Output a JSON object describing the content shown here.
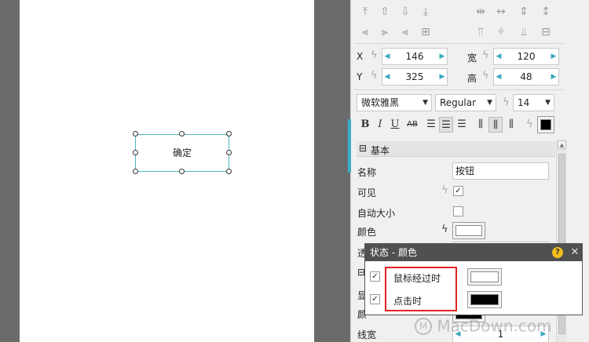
{
  "canvas": {
    "widget_label": "确定"
  },
  "toolbar": {
    "align_row_icons": [
      "align-top-icon",
      "align-middle-icon",
      "align-bottom-icon",
      "align-baseline-icon"
    ],
    "distribute_row_icons": [
      "distribute-horizontal-icon",
      "distribute-width-icon",
      "distribute-vertical-icon",
      "distribute-height-icon"
    ]
  },
  "geometry_fields": {
    "x": {
      "label": "X",
      "value": "146"
    },
    "y": {
      "label": "Y",
      "value": "325"
    },
    "w": {
      "label": "宽",
      "value": "120"
    },
    "h": {
      "label": "高",
      "value": "48"
    }
  },
  "font": {
    "family": "微软雅黑",
    "style": "Regular",
    "size": "14",
    "format_labels": {
      "bold": "B",
      "italic": "I",
      "underline": "U",
      "strike": "AB"
    },
    "color_hex": "#000000"
  },
  "section": {
    "basic_title": "基本",
    "collapse_glyph": "⊟"
  },
  "props": {
    "name_label": "名称",
    "name_value": "按钮",
    "visible_label": "可见",
    "autosize_label": "自动大小",
    "color_label": "颜色",
    "partial_label_1": "透",
    "partial_label_2": "显",
    "partial_label_3": "颜",
    "line_width_label": "线宽",
    "line_width_value": "1",
    "color_swatch_hex": "#ffffff"
  },
  "popup": {
    "title": "状态 - 颜色",
    "help_glyph": "?",
    "close_glyph": "✕",
    "rows": [
      {
        "label": "鼠标经过时",
        "checked": true,
        "color": "#ffffff"
      },
      {
        "label": "点击时",
        "checked": true,
        "color": "#000000"
      }
    ]
  },
  "watermark": {
    "text": "MacDown.com"
  }
}
